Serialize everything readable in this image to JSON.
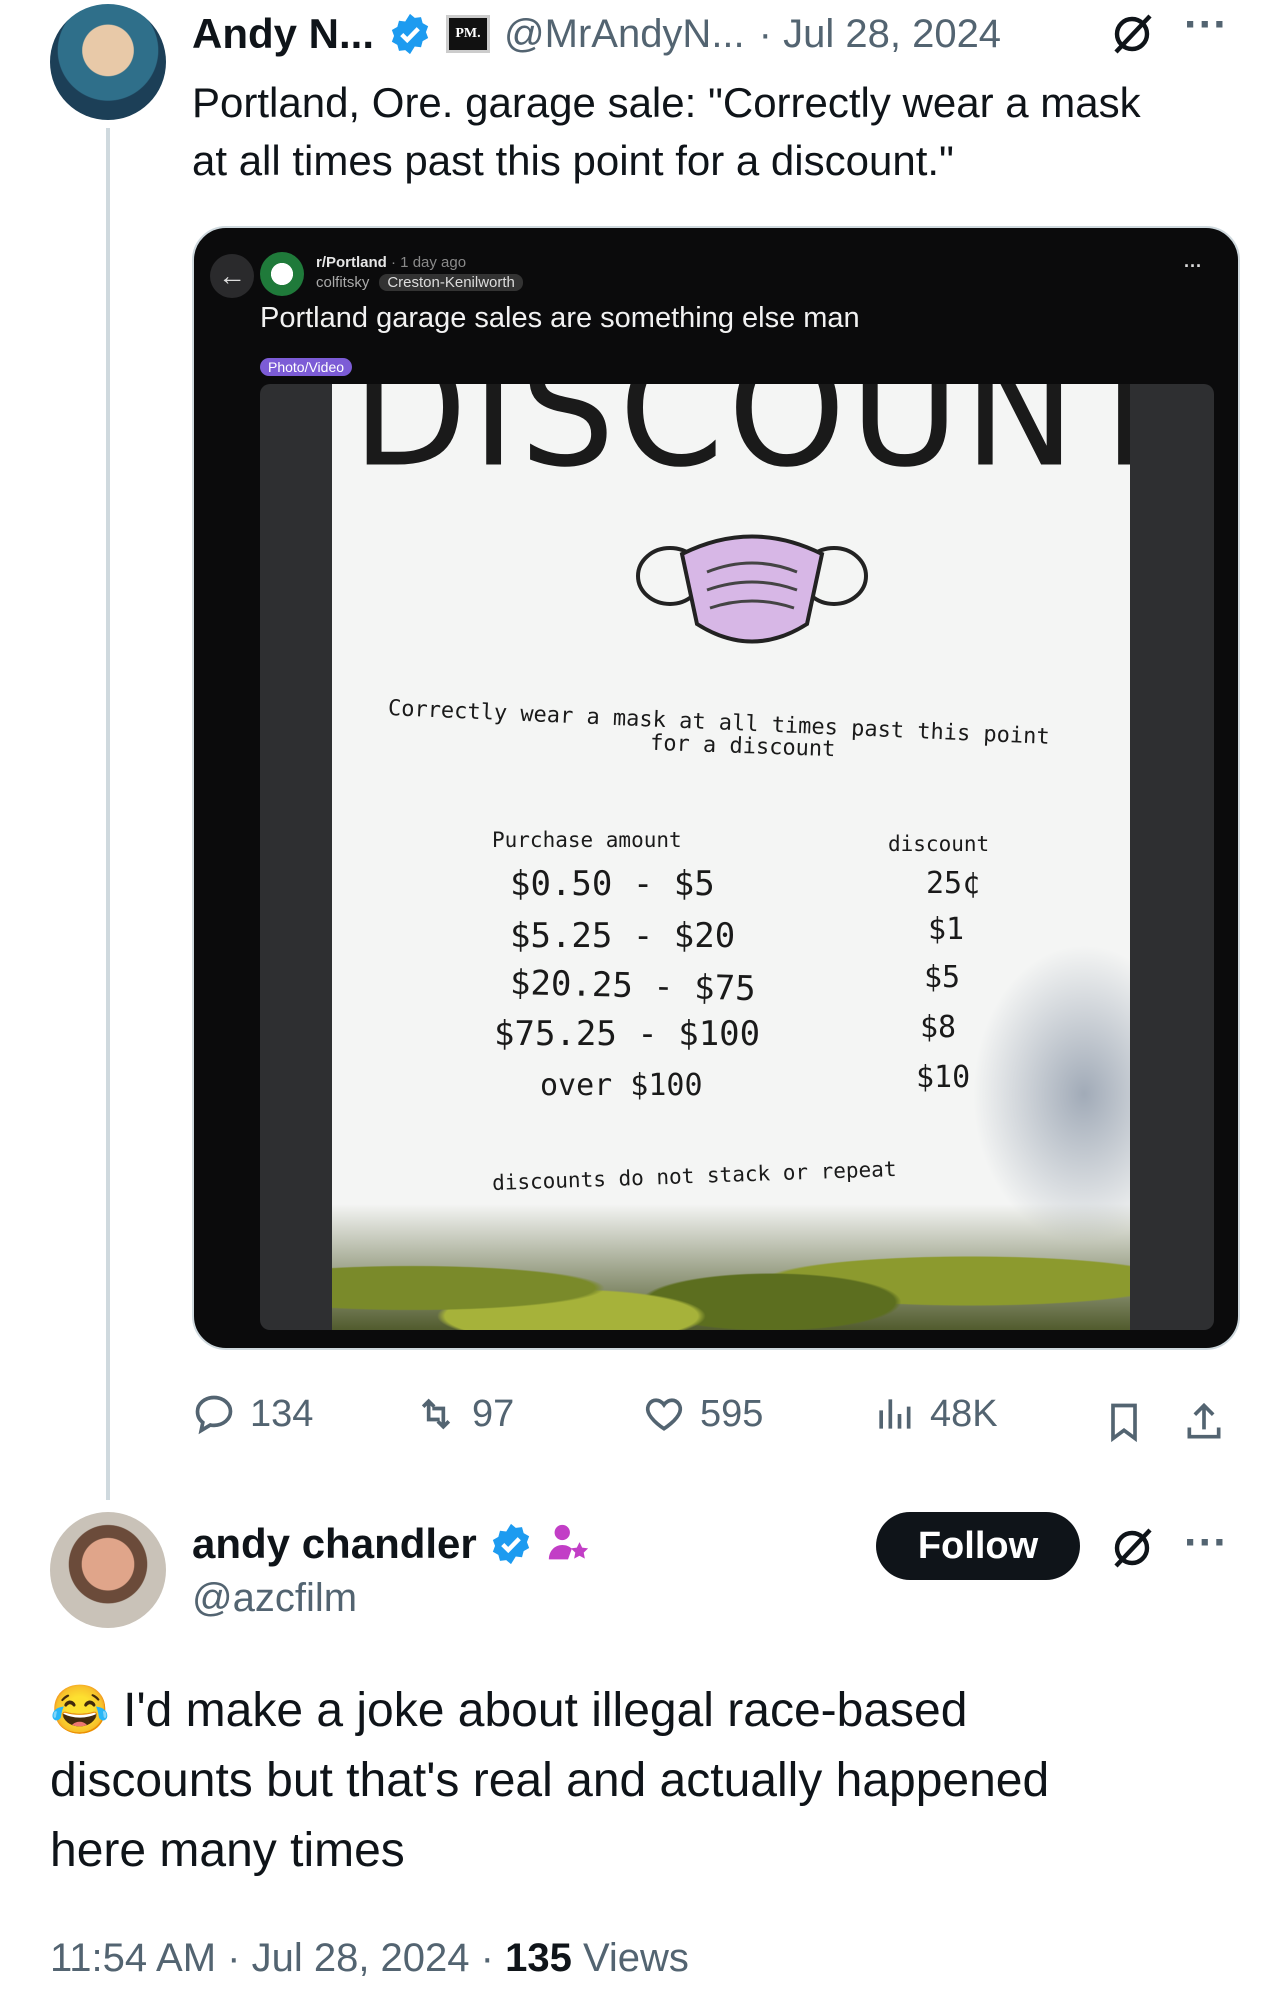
{
  "original_tweet": {
    "author_name": "Andy N...",
    "handle": "@MrAndyN...",
    "date": "· Jul 28, 2024",
    "affiliate_badge": "PM.",
    "text_line1": "Portland, Ore. garage sale: \"Correctly wear a mask",
    "text_line2": "at all times past this point for a discount.\"",
    "stats": {
      "replies": "134",
      "reposts": "97",
      "likes": "595",
      "views": "48K"
    }
  },
  "reddit_card": {
    "subreddit": "r/Portland",
    "age": "· 1 day ago",
    "user": "colfitsky",
    "flair": "Creston-Kenilworth",
    "title": "Portland garage sales are something else man",
    "post_flair": "Photo/Video",
    "more": "···"
  },
  "sign": {
    "header": "DISCOUNT",
    "line1": "Correctly wear a mask at all times past this point",
    "line2": "for a discount",
    "col_purchase": "Purchase amount",
    "col_discount": "discount",
    "rows": [
      {
        "purchase": "$0.50 - $5",
        "discount": "25¢"
      },
      {
        "purchase": "$5.25 - $20",
        "discount": "$1"
      },
      {
        "purchase": "$20.25 - $75",
        "discount": "$5"
      },
      {
        "purchase": "$75.25 - $100",
        "discount": "$8"
      },
      {
        "purchase": "over $100",
        "discount": "$10"
      }
    ],
    "footer": "discounts do not stack or repeat"
  },
  "reply": {
    "author_name": "andy chandler",
    "handle": "@azcfilm",
    "follow_label": "Follow",
    "emoji": "😂",
    "text_line1": "I'd make a joke about illegal race-based",
    "text_line2": "discounts but that's real and actually happened",
    "text_line3": "here many times",
    "time": "11:54 AM · Jul 28, 2024 · ",
    "views_count": "135",
    "views_label": " Views"
  },
  "colors": {
    "verified": "#1d9bf0",
    "text": "#0f1419",
    "muted": "#536471",
    "thread_line": "#cfd9de",
    "post_flair": "#7c5cd6"
  },
  "icons": [
    "verified-badge-icon",
    "grok-icon",
    "more-icon",
    "reply-icon",
    "repost-icon",
    "like-icon",
    "views-icon",
    "bookmark-icon",
    "share-icon",
    "back-arrow-icon",
    "mask-drawing-icon",
    "subscriber-badge-icon"
  ]
}
